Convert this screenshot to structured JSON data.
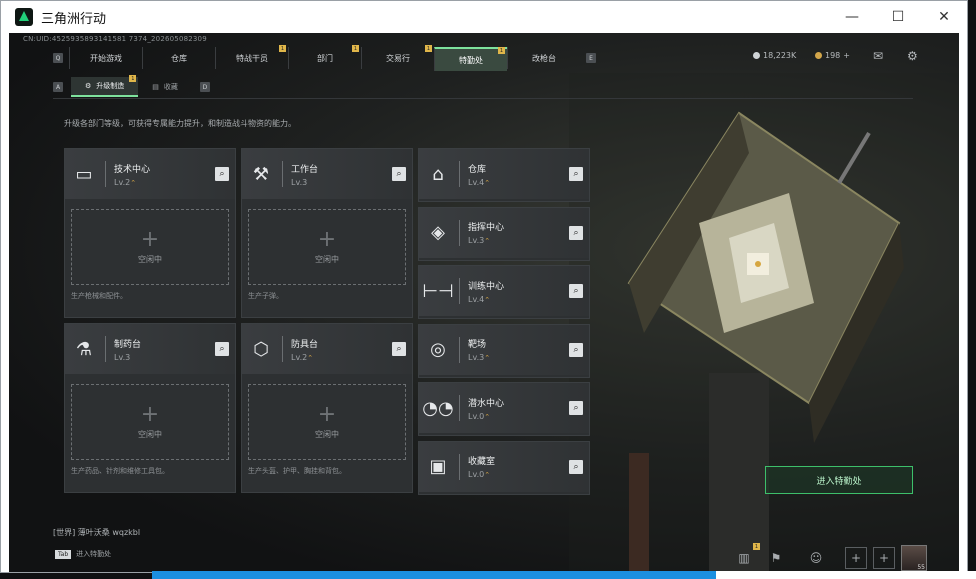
{
  "window": {
    "title": "三角洲行动",
    "minimize": "—",
    "maximize": "☐",
    "close": "✕"
  },
  "uid": "CN:UID:4525935893141581 7374_202605082309",
  "nav": {
    "left_key": "Q",
    "right_key": "E",
    "tabs": [
      {
        "label": "开始游戏",
        "badge": ""
      },
      {
        "label": "仓库",
        "badge": ""
      },
      {
        "label": "特战干员",
        "badge": "1"
      },
      {
        "label": "部门",
        "badge": "1"
      },
      {
        "label": "交易行",
        "badge": "1"
      },
      {
        "label": "特勤处",
        "badge": "1",
        "active": true
      },
      {
        "label": "改枪台",
        "badge": ""
      }
    ]
  },
  "resources": {
    "coins": "18,223K",
    "tickets": "198",
    "plus": "+"
  },
  "subtabs": {
    "left_key": "A",
    "right_key": "D",
    "items": [
      {
        "label": "升级制造",
        "badge": "1"
      },
      {
        "label": "收藏",
        "badge": ""
      }
    ]
  },
  "description": "升级各部门等级，可获得专属能力提升，和制造战斗物资的能力。",
  "idle_label": "空闲中",
  "cards_big": [
    {
      "name": "技术中心",
      "level": "Lv.2",
      "upgradable": true,
      "footer": "生产枪械和配件。",
      "icon": "monitor-icon"
    },
    {
      "name": "工作台",
      "level": "Lv.3",
      "upgradable": false,
      "footer": "生产子弹。",
      "icon": "tools-icon"
    },
    {
      "name": "制药台",
      "level": "Lv.3",
      "upgradable": false,
      "footer": "生产药品、针剂和维修工具包。",
      "icon": "flask-icon"
    },
    {
      "name": "防具台",
      "level": "Lv.2",
      "upgradable": true,
      "footer": "生产头盔、护甲、胸挂和背包。",
      "icon": "hex-icon"
    }
  ],
  "cards_small": [
    {
      "name": "仓库",
      "level": "Lv.4",
      "upgradable": true,
      "icon": "warehouse-icon"
    },
    {
      "name": "指挥中心",
      "level": "Lv.3",
      "upgradable": true,
      "icon": "command-icon"
    },
    {
      "name": "训练中心",
      "level": "Lv.4",
      "upgradable": true,
      "icon": "dumbbell-icon"
    },
    {
      "name": "靶场",
      "level": "Lv.3",
      "upgradable": true,
      "icon": "target-icon"
    },
    {
      "name": "潜水中心",
      "level": "Lv.0",
      "upgradable": true,
      "icon": "goggles-icon"
    },
    {
      "name": "收藏室",
      "level": "Lv.0",
      "upgradable": true,
      "icon": "display-icon"
    }
  ],
  "upgrade_glyph": "⌃",
  "enter_button": "进入特勤处",
  "chat": "[世界] 薄叶沃桑  wqzkbl",
  "tab_hint": {
    "key": "Tab",
    "label": "进入特勤处"
  },
  "bottom": {
    "badge": "1",
    "avatar_level": "55"
  }
}
